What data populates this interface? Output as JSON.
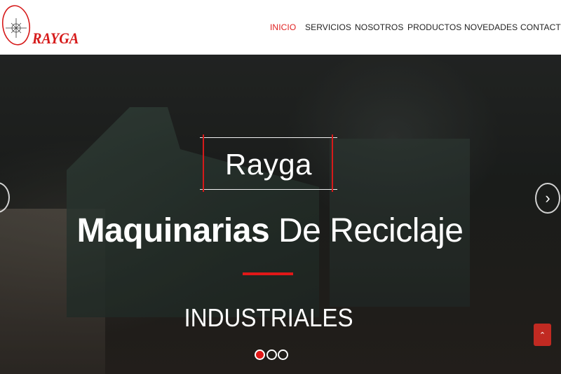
{
  "brand": {
    "logo_text": "RAYGA",
    "color": "#d61a1a"
  },
  "nav": {
    "items": [
      {
        "label": "INICIO",
        "active": true
      },
      {
        "label": "SERVICIOS",
        "active": false
      },
      {
        "label": "NOSOTROS",
        "active": false
      },
      {
        "label": "PRODUCTOS",
        "active": false
      },
      {
        "label": "NOVEDADES",
        "active": false
      },
      {
        "label": "CONTACTO",
        "active": false
      }
    ],
    "active_color": "#e02020"
  },
  "hero": {
    "brand_title": "Rayga",
    "title_bold": "Maquinarias",
    "title_light": "De Reciclaje",
    "subtitle": "INDUSTRIALES",
    "slide_count": 3,
    "active_slide": 1
  },
  "icons": {
    "prev": "chevron-left-icon",
    "next": "chevron-right-icon",
    "scroll_top": "chevron-up-icon"
  }
}
